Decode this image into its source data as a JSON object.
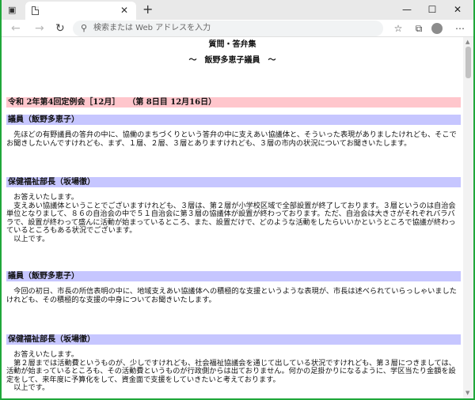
{
  "browser": {
    "address_placeholder": "検索または Web アドレスを入力",
    "icons": {
      "tab_actions": "tab-actions-icon",
      "tab": "page-icon",
      "close": "close-icon",
      "new_tab": "plus-icon",
      "back": "arrow-left-icon",
      "forward": "arrow-right-icon",
      "reload": "reload-icon",
      "search": "search-icon",
      "favorite": "star-icon",
      "collections": "collections-icon",
      "profile": "avatar-icon",
      "menu": "more-icon",
      "minimize": "minimize-icon",
      "maximize": "maximize-icon",
      "window_close": "window-close-icon"
    },
    "glyphs": {
      "tab_actions": "▣",
      "tab_close": "✕",
      "new_tab": "+",
      "back": "←",
      "forward": "→",
      "reload": "↻",
      "search": "⚲",
      "favorite": "☆",
      "collections": "⧉",
      "menu": "⋯",
      "minimize": "—",
      "maximize": "☐",
      "window_close": "✕",
      "scroll_up": "▲",
      "scroll_down": "▼"
    }
  },
  "document": {
    "title": "質問・答弁集",
    "subtitle": "～　飯野多恵子議員　～",
    "session": "令和 2年第4回定例会［12月］　　（第 8日目 12月16日）",
    "entries": [
      {
        "speaker": "議員（飯野多恵子）",
        "text": "　先ほどの有野議員の答弁の中に、協働のまちづくりという答弁の中に支えあい協議体と、そういった表現がありましたけれども、そこでお聞きしたいんですけれども、まず、１層、２層、３層とありますけれども、３層の市内の状況についてお聞きいたします。"
      },
      {
        "speaker": "保健福祉部長（坂場徹）",
        "text": "　お答えいたします。\n　支えあい協議体ということでございますけれども、３層は、第２層が小学校区域で全部設置が終了しております。３層というのは自治会単位となりまして、８６の自治会の中で５１自治会に第３層の協議体が設置が終わっております。ただ、自治会は大きさがそれぞれバラバラで、設置が終わって盛んに活動が始まっているところ、また、設置だけで、どのような活動をしたらいいかというところで協議が終わっているところもある状況でございます。\n　以上です。"
      },
      {
        "speaker": "議員（飯野多恵子）",
        "text": "　今回の初日、市長の所信表明の中に、地域支えあい協議体への積極的な支援というような表現が、市長は述べられていらっしゃいましたけれども、その積極的な支援の中身についてお聞きいたします。"
      },
      {
        "speaker": "保健福祉部長（坂場徹）",
        "text": "　お答えいたします。\n　第２層までは活動費というものが、少しですけれども、社会福祉協議会を通じて出している状況ですけれども、第３層につきましては、活動が始まっているところも、その活動費というものが行政側からは出ておりません。何かの足掛かりになるように、学区当たり金額を設定をして、来年度に予算化をして、資金面で支援をしていきたいと考えております。\n　以上です。"
      }
    ]
  }
}
